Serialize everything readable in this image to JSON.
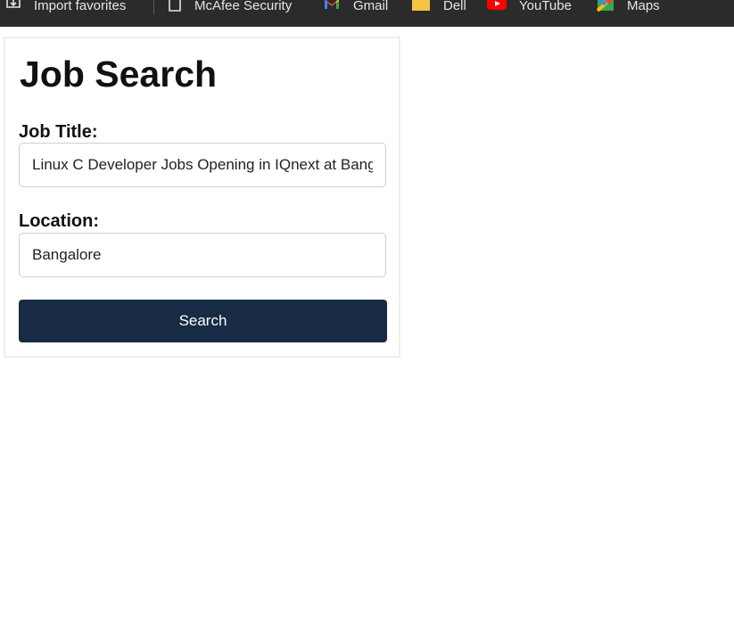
{
  "bookmarks": {
    "items": [
      {
        "label": "Import favorites",
        "icon": "import-icon"
      },
      {
        "label": "McAfee Security",
        "icon": "page-icon"
      },
      {
        "label": "Gmail",
        "icon": "gmail-icon"
      },
      {
        "label": "Dell",
        "icon": "folder-icon"
      },
      {
        "label": "YouTube",
        "icon": "youtube-icon"
      },
      {
        "label": "Maps",
        "icon": "maps-icon"
      }
    ]
  },
  "form": {
    "title": "Job Search",
    "job_title_label": "Job Title:",
    "job_title_value": "Linux C Developer Jobs Opening in IQnext at Bangalore",
    "location_label": "Location:",
    "location_value": "Bangalore",
    "search_label": "Search"
  },
  "colors": {
    "button_bg": "#172b45",
    "bookmarks_bar_bg": "#2b2b2b"
  }
}
